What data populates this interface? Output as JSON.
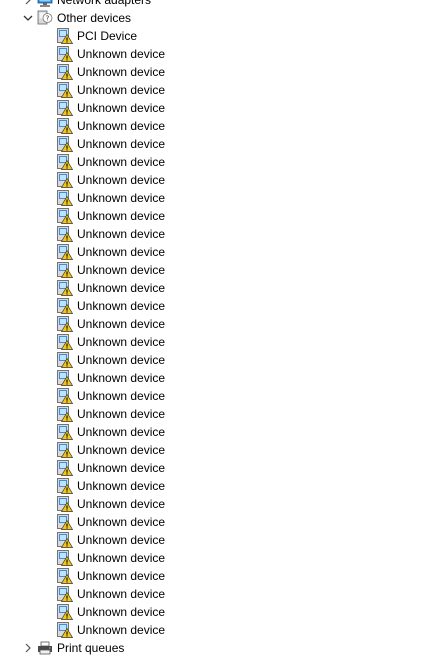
{
  "tree": {
    "network_adapters": {
      "label": "Network adapters",
      "icon": "network-adapter-icon"
    },
    "other_devices": {
      "label": "Other devices",
      "icon": "unknown-device-category-icon",
      "expanded": true,
      "children": [
        "PCI Device",
        "Unknown device",
        "Unknown device",
        "Unknown device",
        "Unknown device",
        "Unknown device",
        "Unknown device",
        "Unknown device",
        "Unknown device",
        "Unknown device",
        "Unknown device",
        "Unknown device",
        "Unknown device",
        "Unknown device",
        "Unknown device",
        "Unknown device",
        "Unknown device",
        "Unknown device",
        "Unknown device",
        "Unknown device",
        "Unknown device",
        "Unknown device",
        "Unknown device",
        "Unknown device",
        "Unknown device",
        "Unknown device",
        "Unknown device",
        "Unknown device",
        "Unknown device",
        "Unknown device",
        "Unknown device",
        "Unknown device",
        "Unknown device",
        "Unknown device"
      ],
      "child_icon": "device-warning-icon"
    },
    "print_queues": {
      "label": "Print queues",
      "icon": "printer-icon"
    }
  },
  "colors": {
    "warning_yellow": "#f5c518",
    "monitor_blue": "#3a8fd8",
    "chevron": "#555555"
  }
}
